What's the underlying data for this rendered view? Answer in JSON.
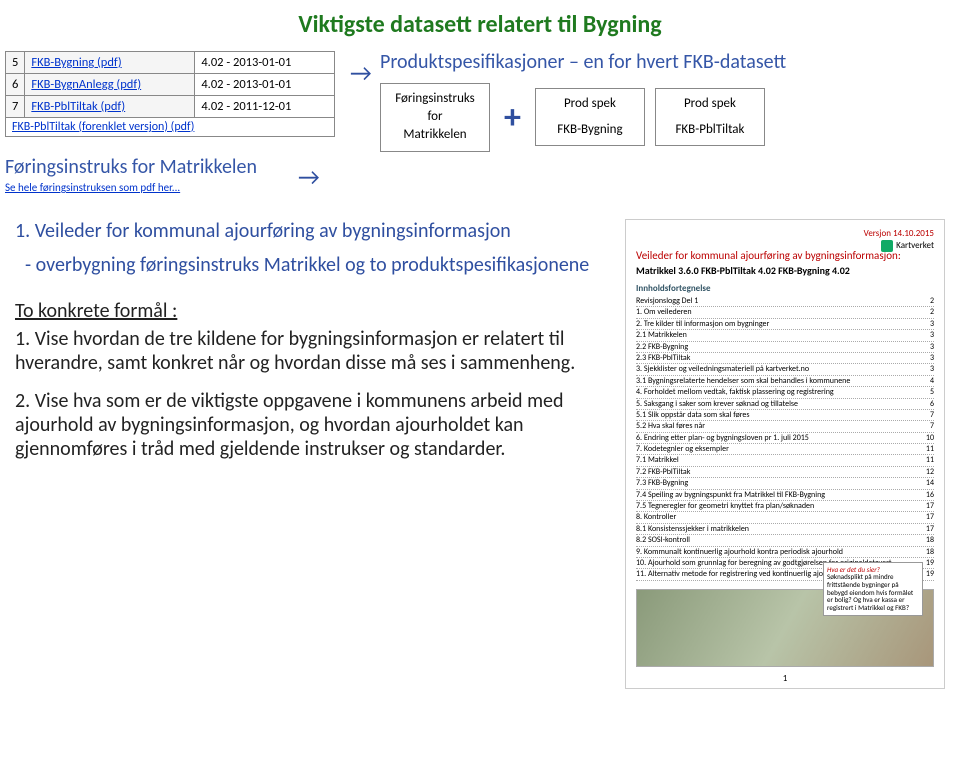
{
  "title": "Viktigste datasett relatert til Bygning",
  "table": {
    "rows": [
      {
        "num": "5",
        "name": "FKB-Bygning (pdf)",
        "ver": "4.02 - 2013-01-01"
      },
      {
        "num": "6",
        "name": "FKB-BygnAnlegg (pdf)",
        "ver": "4.02 - 2013-01-01"
      },
      {
        "num": "7",
        "name": "FKB-PblTiltak (pdf)",
        "ver": "4.02 - 2011-12-01"
      }
    ],
    "subrow": "FKB-PblTiltak (forenklet versjon) (pdf)"
  },
  "foringsinstruks_label": "Føringsinstruks for Matrikkelen",
  "hele_link": "Se hele føringsinstruksen som pdf her...",
  "arrow": "→",
  "prod_spek_title": "Produktspesifikasjoner – en for hvert FKB-datasett",
  "boxes": {
    "box1": {
      "line1": "Føringsinstruks",
      "line2": "for",
      "line3": "Matrikkelen"
    },
    "box2": {
      "line1": "Prod spek",
      "line2": "FKB-Bygning"
    },
    "box3": {
      "line1": "Prod spek",
      "line2": "FKB-PblTiltak"
    }
  },
  "plus": "+",
  "section1": {
    "head": "1. Veileder for kommunal ajourføring av bygningsinformasjon",
    "body": "- overbygning føringsinstruks Matrikkel og to produktspesifikasjonene"
  },
  "formal_title": "To konkrete formål :",
  "para1": "1. Vise hvordan de tre kildene for bygningsinformasjon er relatert til hverandre, samt konkret når og hvordan disse må ses i sammenheng.",
  "para2": "2. Vise hva som er de viktigste oppgavene i kommunens arbeid med ajourhold av bygningsinformasjon, og hvordan ajourholdet kan gjennomføres i tråd med gjeldende instrukser og standarder.",
  "doc": {
    "version": "Versjon 14.10.2015",
    "logo": "Kartverket",
    "title": "Veileder for kommunal ajourføring av bygningsinformasjon:",
    "subtitle": "Matrikkel 3.6.0  FKB-PblTiltak 4.02  FKB-Bygning 4.02",
    "toc_head": "Innholdsfortegnelse",
    "toc": [
      {
        "t": "Revisjonslogg Del 1",
        "p": "2"
      },
      {
        "t": "1. Om veilederen",
        "p": "2"
      },
      {
        "t": "2. Tre kilder til informasjon om bygninger",
        "p": "3"
      },
      {
        "t": "2.1 Matrikkelen",
        "p": "3"
      },
      {
        "t": "2.2 FKB-Bygning",
        "p": "3"
      },
      {
        "t": "2.3 FKB-PblTiltak",
        "p": "3"
      },
      {
        "t": "3. Sjekklister og veiledningsmateriell på kartverket.no",
        "p": "3"
      },
      {
        "t": "3.1 Bygningsrelaterte hendelser som skal behandles i kommunene",
        "p": "4"
      },
      {
        "t": "4. Forholdet mellom vedtak, faktisk plassering og registrering",
        "p": "5"
      },
      {
        "t": "5. Saksgang i saker som krever søknad og tillatelse",
        "p": "6"
      },
      {
        "t": "5.1 Slik oppstår data som skal føres",
        "p": "7"
      },
      {
        "t": "5.2 Hva skal føres når",
        "p": "7"
      },
      {
        "t": "6. Endring etter plan- og bygningsloven pr 1. juli 2015",
        "p": "10"
      },
      {
        "t": "7. Kodetegnler og eksempler",
        "p": "11"
      },
      {
        "t": "7.1 Matrikkel",
        "p": "11"
      },
      {
        "t": "7.2 FKB-PblTiltak",
        "p": "12"
      },
      {
        "t": "7.3 FKB-Bygning",
        "p": "14"
      },
      {
        "t": "7.4 Speiling av bygningspunkt fra Matrikkel til FKB-Bygning",
        "p": "16"
      },
      {
        "t": "7.5 Tegneregler for geometri knyttet fra plan/søknaden",
        "p": "17"
      },
      {
        "t": "8. Kontroller",
        "p": "17"
      },
      {
        "t": "8.1 Konsistenssjekker i matrikkelen",
        "p": "17"
      },
      {
        "t": "8.2 SOSI-kontroll",
        "p": "18"
      },
      {
        "t": "9. Kommunalt kontinuerlig ajourhold kontra periodisk ajourhold",
        "p": "18"
      },
      {
        "t": "10. Ajourhold som grunnlag for beregning av godtgjørelsen for originaldatavert",
        "p": "19"
      },
      {
        "t": "11. Alternativ metode for registrering ved kontinuerlig ajourhold",
        "p": "19"
      }
    ],
    "callout_q": "Hva er det du sier?",
    "callout_body": "Søknadsplikt på mindre frittstående bygninger på bebygd eiendom hvis formålet er bolig?\nOg hva er kassa er registrert i Matrikkel og FKB?",
    "pagenum": "1"
  }
}
